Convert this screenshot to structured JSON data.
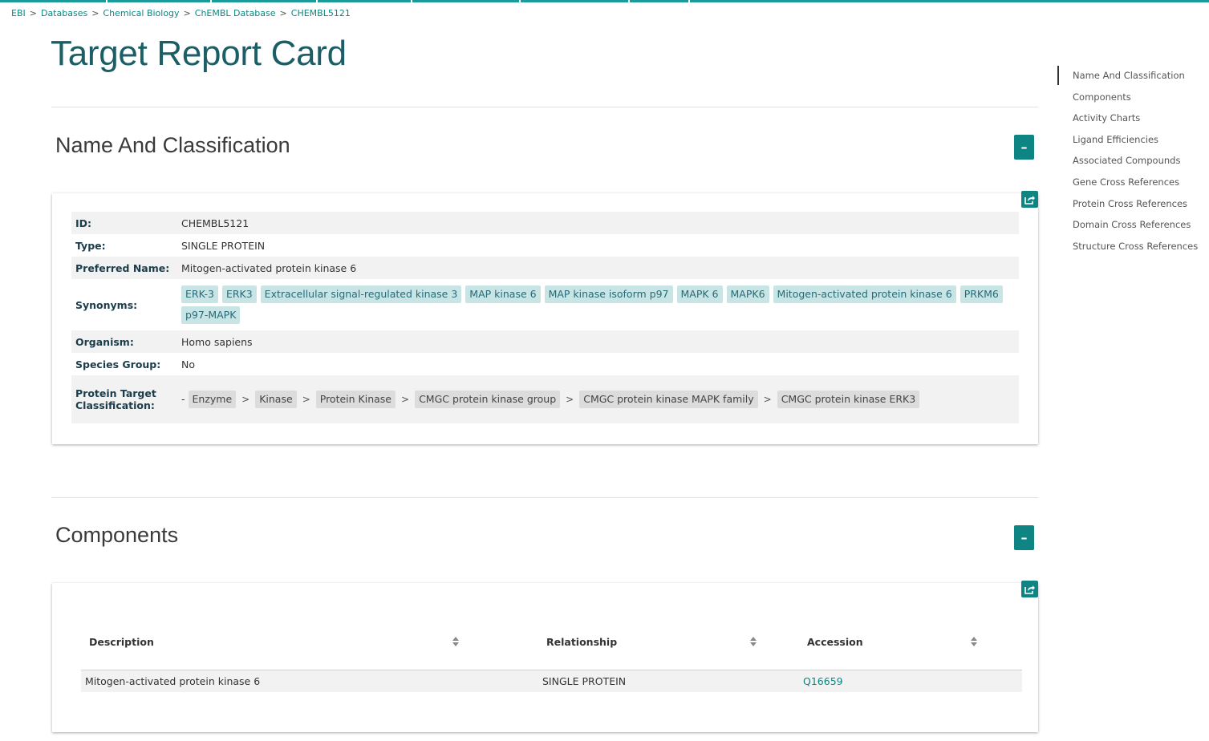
{
  "breadcrumb": [
    "EBI",
    "Databases",
    "Chemical Biology",
    "ChEMBL Database",
    "CHEMBL5121"
  ],
  "page_title": "Target Report Card",
  "colors": {
    "accent": "#0e8583",
    "title": "#1b5e66",
    "synonym_tag_bg": "#c8e4e4",
    "class_tag_bg": "#dcdcdc"
  },
  "sections": {
    "name_classification": {
      "title": "Name And Classification",
      "collapse_label": "–",
      "id_label": "ID:",
      "id_value": "CHEMBL5121",
      "type_label": "Type:",
      "type_value": "SINGLE PROTEIN",
      "pref_label": "Preferred Name:",
      "pref_value": "Mitogen-activated protein kinase 6",
      "syn_label": "Synonyms:",
      "synonyms": [
        "ERK-3",
        "ERK3",
        "Extracellular signal-regulated kinase 3",
        "MAP kinase 6",
        "MAP kinase isoform p97",
        "MAPK 6",
        "MAPK6",
        "Mitogen-activated protein kinase 6",
        "PRKM6",
        "p97-MAPK"
      ],
      "org_label": "Organism:",
      "org_value": "Homo sapiens",
      "species_label": "Species Group:",
      "species_value": "No",
      "class_label_1": "Protein Target",
      "class_label_2": "Classification:",
      "class_prefix": "-",
      "classification": [
        "Enzyme",
        "Kinase",
        "Protein Kinase",
        "CMGC protein kinase group",
        "CMGC protein kinase MAPK family",
        "CMGC protein kinase ERK3"
      ],
      "class_sep": ">"
    },
    "components": {
      "title": "Components",
      "collapse_label": "–",
      "headers": [
        "Description",
        "Relationship",
        "Accession"
      ],
      "rows": [
        {
          "description": "Mitogen-activated protein kinase 6",
          "relationship": "SINGLE PROTEIN",
          "accession": "Q16659"
        }
      ]
    }
  },
  "toc": [
    "Name And Classification",
    "Components",
    "Activity Charts",
    "Ligand Efficiencies",
    "Associated Compounds",
    "Gene Cross References",
    "Protein Cross References",
    "Domain Cross References",
    "Structure Cross References"
  ],
  "icons": {
    "share": "share-icon",
    "sort": "sort-icon"
  }
}
